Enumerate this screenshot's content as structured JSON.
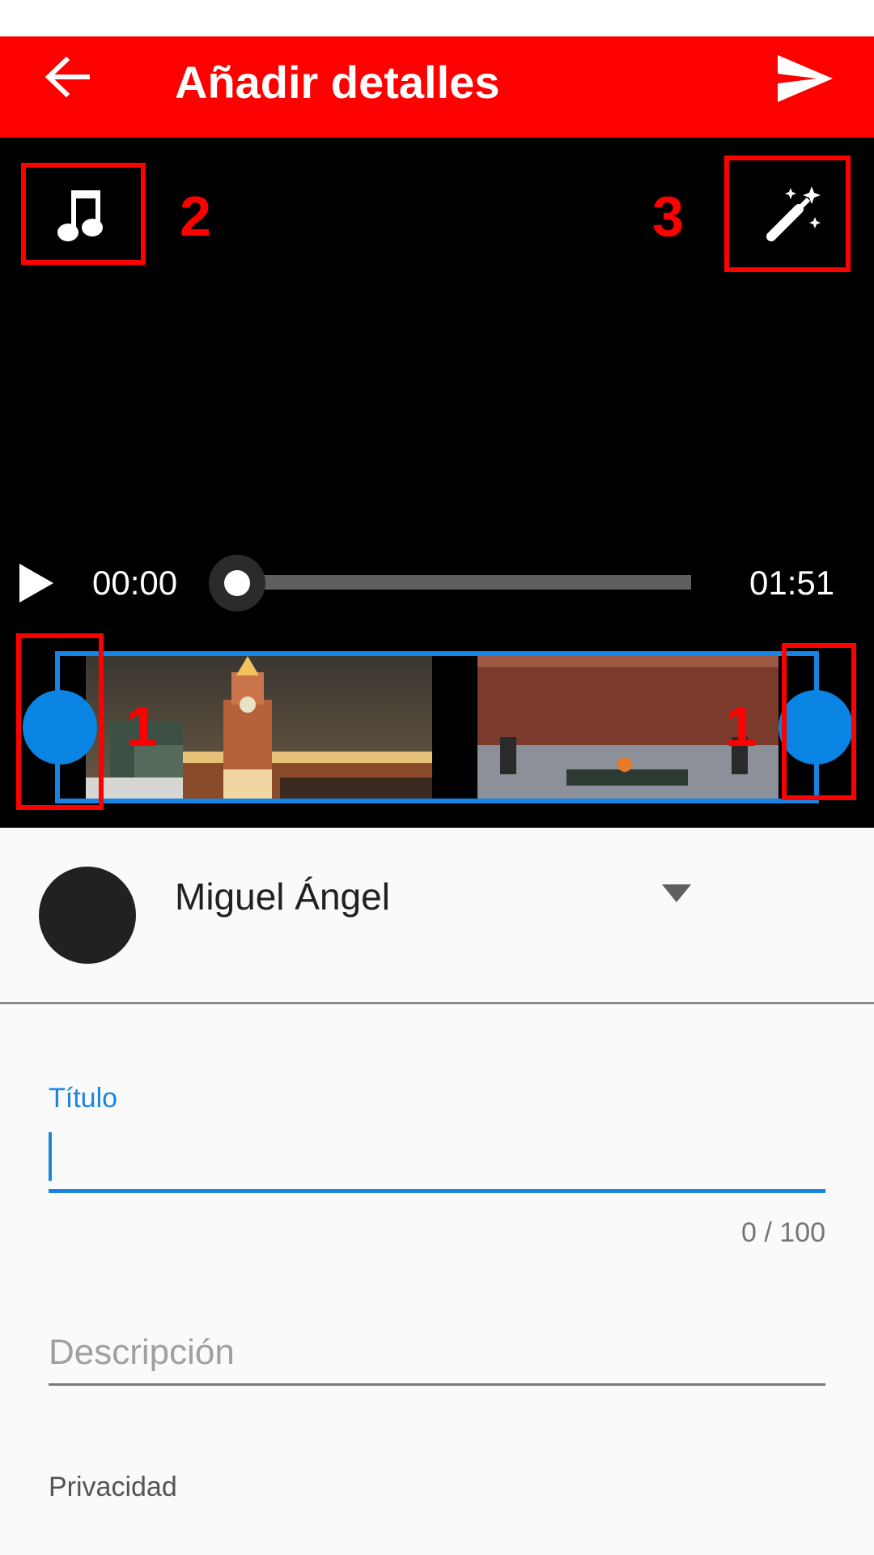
{
  "app_bar": {
    "title": "Añadir detalles",
    "back_icon": "arrow-back-icon",
    "send_icon": "send-icon",
    "color": "#ff0000"
  },
  "player": {
    "music_icon": "music-note-icon",
    "effects_icon": "magic-wand-icon",
    "annotation_music": "2",
    "annotation_effects": "3",
    "annotation_trim_left": "1",
    "annotation_trim_right": "1",
    "current_time": "00:00",
    "total_time": "01:51",
    "progress": 0,
    "thumbnails": [
      "kremlin-tower-night",
      "eternal-flame-wall"
    ]
  },
  "account": {
    "name": "Miguel Ángel",
    "dropdown_icon": "arrow-drop-down-icon"
  },
  "form": {
    "title_label": "Título",
    "title_value": "",
    "title_counter": "0 / 100",
    "description_placeholder": "Descripción",
    "privacy_label": "Privacidad"
  },
  "colors": {
    "accent": "#1a86e0",
    "annotation": "#ff0000"
  }
}
